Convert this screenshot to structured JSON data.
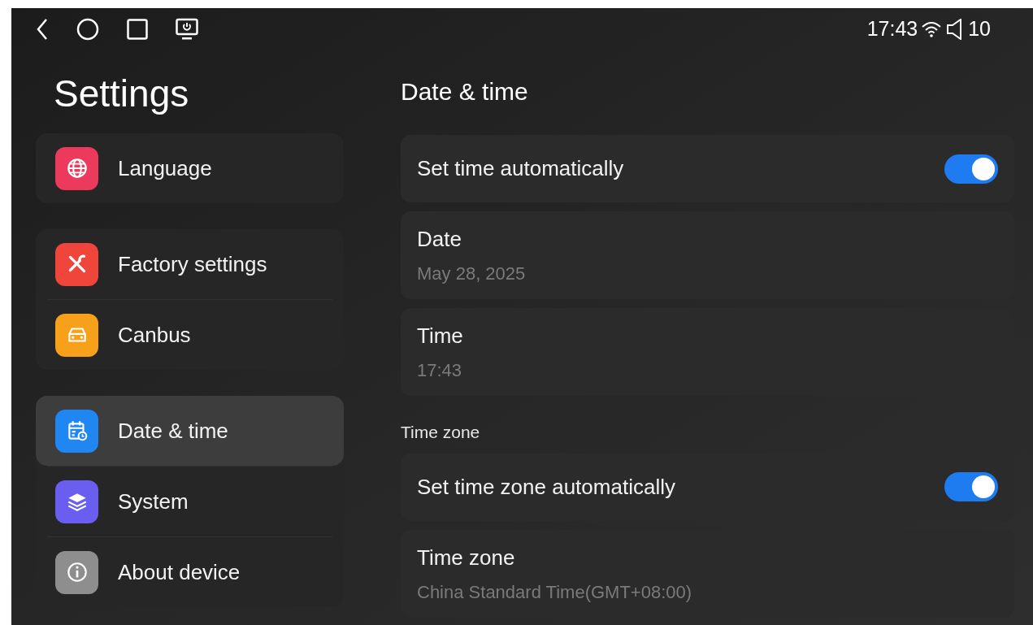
{
  "status_bar": {
    "time": "17:43",
    "volume": "10"
  },
  "sidebar": {
    "title": "Settings",
    "groups": [
      {
        "items": [
          {
            "label": "Language",
            "kind": "globe",
            "color": "#ec3a5c",
            "selected": false
          }
        ]
      },
      {
        "items": [
          {
            "label": "Factory settings",
            "kind": "tools",
            "color": "#f0453a",
            "selected": false
          },
          {
            "label": "Canbus",
            "kind": "car",
            "color": "#f7a11a",
            "selected": false
          }
        ]
      },
      {
        "items": [
          {
            "label": "Date & time",
            "kind": "calendar",
            "color": "#1f86f2",
            "selected": true
          },
          {
            "label": "System",
            "kind": "layers",
            "color": "#6a5ef0",
            "selected": false
          },
          {
            "label": "About device",
            "kind": "info",
            "color": "#8e8e8e",
            "selected": false
          }
        ]
      }
    ]
  },
  "content": {
    "title": "Date & time",
    "sections": [
      {
        "rows": [
          {
            "kind": "switch",
            "label": "Set time automatically",
            "on": true
          },
          {
            "kind": "value",
            "label": "Date",
            "value": "May 28, 2025"
          },
          {
            "kind": "value",
            "label": "Time",
            "value": "17:43"
          }
        ]
      },
      {
        "header": "Time zone",
        "rows": [
          {
            "kind": "switch",
            "label": "Set time zone automatically",
            "on": true
          },
          {
            "kind": "value",
            "label": "Time zone",
            "value": "China Standard Time(GMT+08:00)"
          }
        ]
      }
    ]
  }
}
